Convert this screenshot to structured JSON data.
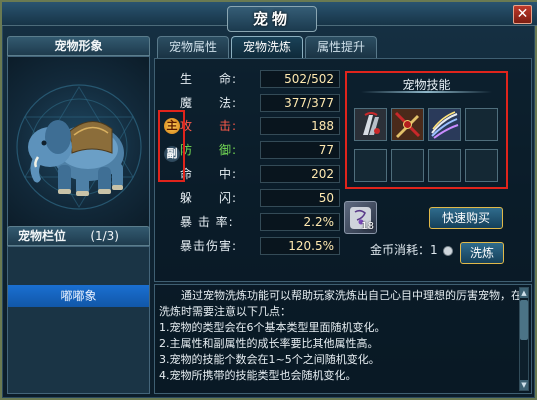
{
  "window": {
    "title": "宠物",
    "close_label": "✕"
  },
  "tabs": [
    {
      "label": "宠物属性"
    },
    {
      "label": "宠物洗炼"
    },
    {
      "label": "属性提升"
    }
  ],
  "active_tab": "宠物洗炼",
  "left": {
    "pet_view_title": "宠物形象",
    "slot_title": "宠物栏位",
    "slot_count": "(1/3)",
    "pets": [
      {
        "name": "嘟嘟象"
      }
    ]
  },
  "roles": {
    "main": "主",
    "sub": "副"
  },
  "stats": [
    {
      "label": "生　　命:",
      "value": "502/502",
      "color": "white"
    },
    {
      "label": "魔　　法:",
      "value": "377/377",
      "color": "white"
    },
    {
      "label": "攻　　击:",
      "value": "188",
      "color": "red"
    },
    {
      "label": "防　　御:",
      "value": "77",
      "color": "green"
    },
    {
      "label": "命　　中:",
      "value": "202",
      "color": "white"
    },
    {
      "label": "躲　　闪:",
      "value": "50",
      "color": "white"
    },
    {
      "label": "暴 击 率:",
      "value": "2.2%",
      "color": "white"
    },
    {
      "label": "暴击伤害:",
      "value": "120.5%",
      "color": "white"
    }
  ],
  "skills": {
    "title": "宠物技能",
    "slots": [
      {
        "icon": "claw-skill-icon",
        "filled": true
      },
      {
        "icon": "sword-skill-icon",
        "filled": true
      },
      {
        "icon": "slash-skill-icon",
        "filled": true
      },
      {
        "filled": false
      },
      {
        "filled": false
      },
      {
        "filled": false
      },
      {
        "filled": false
      },
      {
        "filled": false
      }
    ]
  },
  "item": {
    "icon": "scroll-item-icon",
    "count": "18"
  },
  "buttons": {
    "quick_buy": "快速购买",
    "refine": "洗炼"
  },
  "coin": {
    "label": "金币消耗：",
    "value": "1"
  },
  "description": {
    "intro": "通过宠物洗炼功能可以帮助玩家洗炼出自己心目中理想的厉害宠物，在洗炼时需要注意以下几点：",
    "points": [
      "1.宠物的类型会在6个基本类型里面随机变化。",
      "2.主属性和副属性的成长率要比其他属性高。",
      "3.宠物的技能个数会在1~5个之间随机变化。",
      "4.宠物所携带的技能类型也会随机变化。"
    ]
  },
  "colors": {
    "accent_red": "#e0241c",
    "selected_blue": "#1a6fd1",
    "value_text": "#ffe9b0"
  }
}
